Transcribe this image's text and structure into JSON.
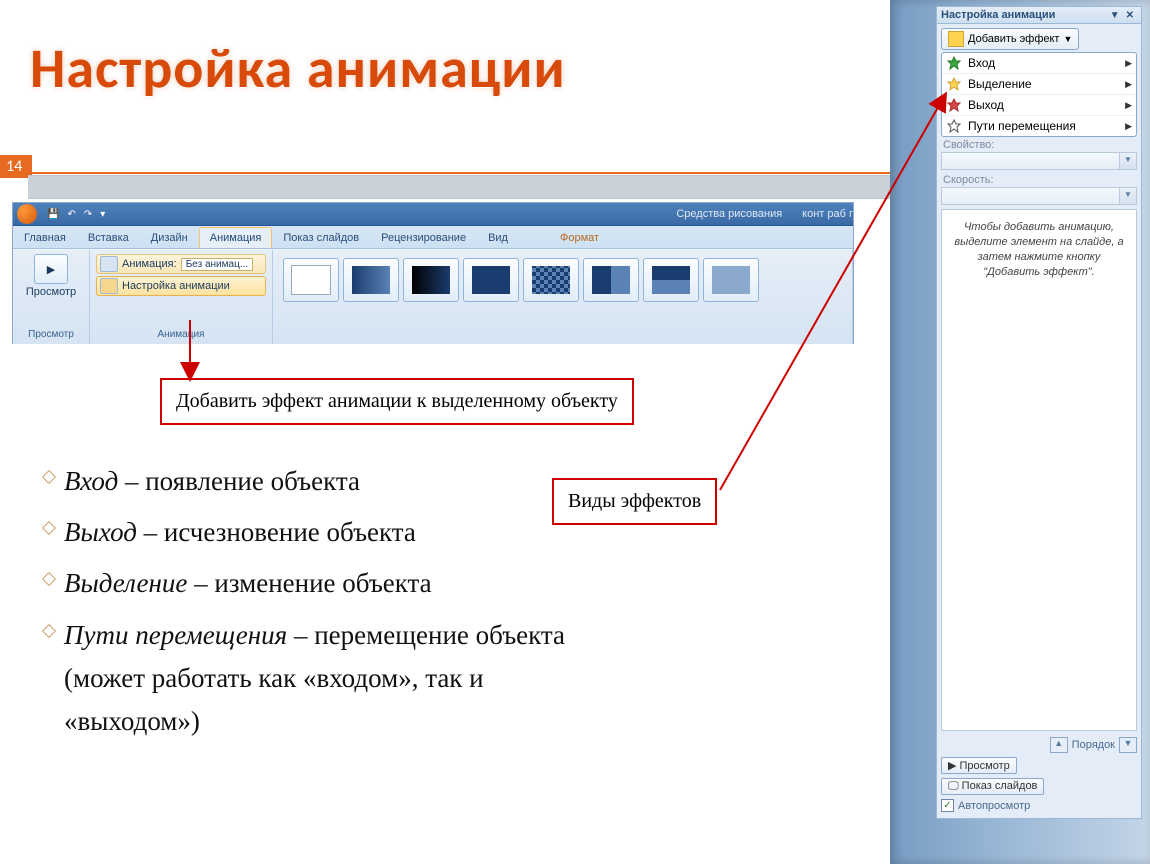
{
  "title": "Настройка анимации",
  "page_number": "14",
  "ribbon": {
    "qat": {
      "contextual": "Средства рисования",
      "doc": "конт раб г"
    },
    "tabs": [
      "Главная",
      "Вставка",
      "Дизайн",
      "Анимация",
      "Показ слайдов",
      "Рецензирование",
      "Вид",
      "Формат"
    ],
    "active_tab_index": 3,
    "group_preview": {
      "button": "Просмотр",
      "label": "Просмотр"
    },
    "group_anim": {
      "row1_label": "Анимация:",
      "row1_value": "Без анимац...",
      "row2_label": "Настройка анимации",
      "label": "Анимация"
    }
  },
  "callout1": "Добавить эффект анимации к выделенному объекту",
  "callout2": "Виды эффектов",
  "bullets": [
    {
      "term": "Вход",
      "desc": " – появление объекта"
    },
    {
      "term": "Выход",
      "desc": " – исчезновение объекта"
    },
    {
      "term": "Выделение",
      "desc": " – изменение объекта"
    },
    {
      "term": "Пути перемещения",
      "desc": " – перемещение объекта (может работать как «входом», так и «выходом»)"
    }
  ],
  "pane": {
    "title": "Настройка анимации",
    "add_effect": "Добавить эффект",
    "menu": [
      {
        "icon": "star-green",
        "label": "Вход"
      },
      {
        "icon": "star-yellow",
        "label": "Выделение"
      },
      {
        "icon": "star-red",
        "label": "Выход"
      },
      {
        "icon": "star-outline",
        "label": "Пути перемещения"
      }
    ],
    "fields": [
      {
        "label": "Свойство:"
      },
      {
        "label": "Скорость:"
      }
    ],
    "hint": "Чтобы добавить анимацию, выделите элемент на слайде, а затем нажмите кнопку \"Добавить эффект\".",
    "order_label": "Порядок",
    "preview_btn": "Просмотр",
    "slideshow_btn": "Показ слайдов",
    "autopreview": "Автопросмотр"
  }
}
